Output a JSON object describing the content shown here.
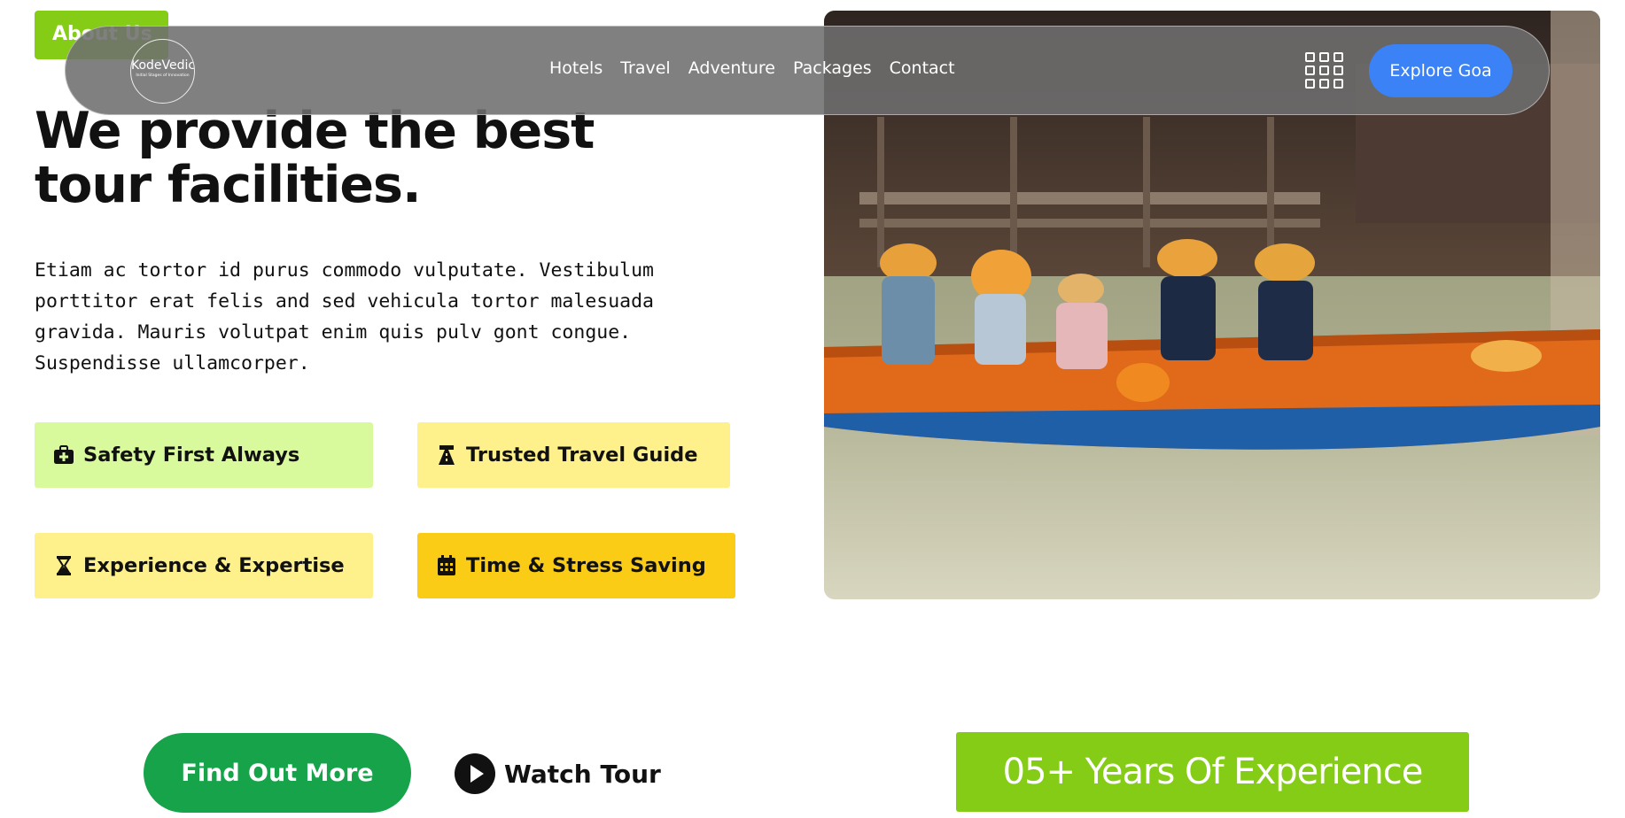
{
  "about_badge": {
    "label": "About Us"
  },
  "navbar": {
    "logo": {
      "name": "KodeVedic",
      "tagline": "Initial Stages of Innovation"
    },
    "links": [
      {
        "label": "Hotels"
      },
      {
        "label": "Travel"
      },
      {
        "label": "Adventure"
      },
      {
        "label": "Packages"
      },
      {
        "label": "Contact"
      }
    ],
    "menu_icon": "grid-icon",
    "cta": {
      "label": "Explore Goa",
      "color": "#3b82f6"
    }
  },
  "hero": {
    "headline": "We provide the best tour facilities.",
    "description": "Etiam ac tortor id purus commodo vulputate. Vestibulum porttitor erat felis and sed vehicula tortor malesuada gravida. Mauris volutpat enim quis pulv gont congue. Suspendisse ullamcorper."
  },
  "features": [
    {
      "label": "Safety First Always",
      "icon": "first-aid-kit-icon",
      "color": "#d9f99d"
    },
    {
      "label": "Trusted Travel Guide",
      "icon": "road-sign-icon",
      "color": "#fef08a"
    },
    {
      "label": "Experience & Expertise",
      "icon": "hourglass-icon",
      "color": "#fef08a"
    },
    {
      "label": "Time & Stress Saving",
      "icon": "calendar-icon",
      "color": "#facc15"
    }
  ],
  "actions": {
    "find_out_more": "Find Out More",
    "watch_tour": "Watch Tour"
  },
  "experience_badge": {
    "label": "05+ Years Of Experience",
    "color": "#84cc16"
  },
  "image": {
    "subject": "tourists-in-orange-boat-on-river-icon"
  }
}
